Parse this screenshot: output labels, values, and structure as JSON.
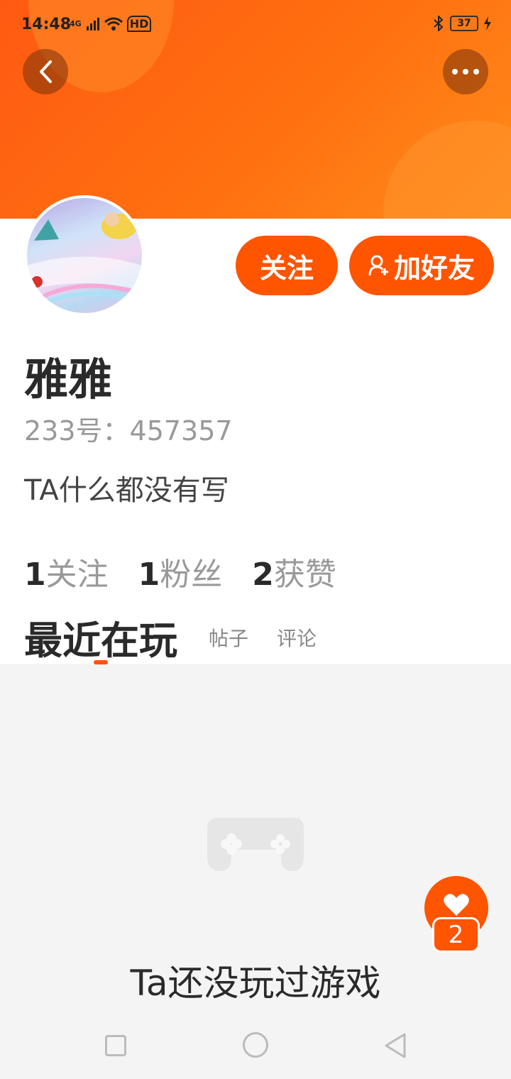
{
  "status_bar": {
    "time": "14:48",
    "network": "4G",
    "hd": "HD",
    "battery": "37"
  },
  "header": {
    "back_icon": "chevron-left-icon",
    "more_icon": "more-dots-icon",
    "gradient_start": "#ff5a12",
    "gradient_end": "#ff8c1a"
  },
  "profile": {
    "name": "雅雅",
    "id_label": "233号：457357",
    "bio": "TA什么都没有写"
  },
  "actions": {
    "follow_label": "关注",
    "add_friend_label": "加好友"
  },
  "stats": [
    {
      "num": "1",
      "label": "关注"
    },
    {
      "num": "1",
      "label": "粉丝"
    },
    {
      "num": "2",
      "label": "获赞"
    }
  ],
  "tabs": {
    "active": "最近在玩",
    "posts": "帖子",
    "comments": "评论"
  },
  "empty_state": {
    "message": "Ta还没玩过游戏"
  },
  "like_fab": {
    "count": "2"
  },
  "colors": {
    "accent": "#ff5400",
    "text_dark": "#2a2a2a",
    "text_muted": "#999999"
  }
}
